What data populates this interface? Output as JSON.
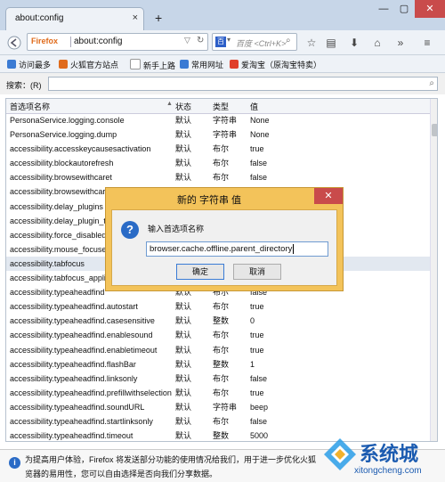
{
  "tab": {
    "title": "about:config",
    "close": "×",
    "new_tab": "+"
  },
  "window": {
    "minimize": "—",
    "maximize": "▢",
    "close": "✕"
  },
  "nav": {
    "brand": "Firefox",
    "url": "about:config",
    "search_engine_label": "百",
    "search_placeholder": "百度 <Ctrl+K>"
  },
  "bookmarks": [
    {
      "label": "访问最多",
      "color": "#3b7bd4"
    },
    {
      "label": "火狐官方站点",
      "color": "#e06b1b"
    },
    {
      "label": "新手上路",
      "color": "#ffffff"
    },
    {
      "label": "常用网址",
      "color": "#3b7bd4"
    },
    {
      "label": "爱淘宝（原淘宝特卖）",
      "color": "#e0402a"
    }
  ],
  "filter": {
    "label": "搜索：(R)"
  },
  "table": {
    "headers": {
      "name": "首选项名称",
      "status": "状态",
      "type": "类型",
      "value": "值"
    },
    "rows": [
      {
        "name": "PersonaService.logging.console",
        "status": "默认",
        "type": "字符串",
        "value": "None"
      },
      {
        "name": "PersonaService.logging.dump",
        "status": "默认",
        "type": "字符串",
        "value": "None"
      },
      {
        "name": "accessibility.accesskeycausesactivation",
        "status": "默认",
        "type": "布尔",
        "value": "true"
      },
      {
        "name": "accessibility.blockautorefresh",
        "status": "默认",
        "type": "布尔",
        "value": "false"
      },
      {
        "name": "accessibility.browsewithcaret",
        "status": "默认",
        "type": "布尔",
        "value": "false"
      },
      {
        "name": "accessibility.browsewithcaret_shortcut.enabled",
        "status": "默认",
        "type": "布尔",
        "value": "true"
      },
      {
        "name": "accessibility.delay_plugins",
        "status": "默认",
        "type": "布尔",
        "value": "false"
      },
      {
        "name": "accessibility.delay_plugin_time",
        "status": "默认",
        "type": "整数",
        "value": "10000"
      },
      {
        "name": "accessibility.force_disabled",
        "status": "默认",
        "type": "整数",
        "value": "0"
      },
      {
        "name": "accessibility.mouse_focuses_formcontrol",
        "status": "默认",
        "type": "布尔",
        "value": "false"
      },
      {
        "name": "accessibility.tabfocus",
        "status": "默认",
        "type": "整数",
        "value": "7"
      },
      {
        "name": "accessibility.tabfocus_applies_to_xul",
        "status": "默认",
        "type": "布尔",
        "value": "false"
      },
      {
        "name": "accessibility.typeaheadfind",
        "status": "默认",
        "type": "布尔",
        "value": "false"
      },
      {
        "name": "accessibility.typeaheadfind.autostart",
        "status": "默认",
        "type": "布尔",
        "value": "true"
      },
      {
        "name": "accessibility.typeaheadfind.casesensitive",
        "status": "默认",
        "type": "整数",
        "value": "0"
      },
      {
        "name": "accessibility.typeaheadfind.enablesound",
        "status": "默认",
        "type": "布尔",
        "value": "true"
      },
      {
        "name": "accessibility.typeaheadfind.enabletimeout",
        "status": "默认",
        "type": "布尔",
        "value": "true"
      },
      {
        "name": "accessibility.typeaheadfind.flashBar",
        "status": "默认",
        "type": "整数",
        "value": "1"
      },
      {
        "name": "accessibility.typeaheadfind.linksonly",
        "status": "默认",
        "type": "布尔",
        "value": "false"
      },
      {
        "name": "accessibility.typeaheadfind.prefillwithselection",
        "status": "默认",
        "type": "布尔",
        "value": "true"
      },
      {
        "name": "accessibility.typeaheadfind.soundURL",
        "status": "默认",
        "type": "字符串",
        "value": "beep"
      },
      {
        "name": "accessibility.typeaheadfind.startlinksonly",
        "status": "默认",
        "type": "布尔",
        "value": "false"
      },
      {
        "name": "accessibility.typeaheadfind.timeout",
        "status": "默认",
        "type": "整数",
        "value": "5000"
      }
    ]
  },
  "notice": {
    "line1": "为提高用户体验，Firefox 将发送部分功能的使用情况给我们，用于进一步优化火狐",
    "line2": "览器的易用性，您可以自由选择是否向我们分享数据。"
  },
  "watermark": {
    "text": "系统城",
    "url": "xitongcheng.com"
  },
  "dialog": {
    "title": "新的 字符串 值",
    "close": "✕",
    "prompt": "输入首选项名称",
    "input_value": "browser.cache.offline.parent_directory",
    "ok": "确定",
    "cancel": "取消"
  }
}
